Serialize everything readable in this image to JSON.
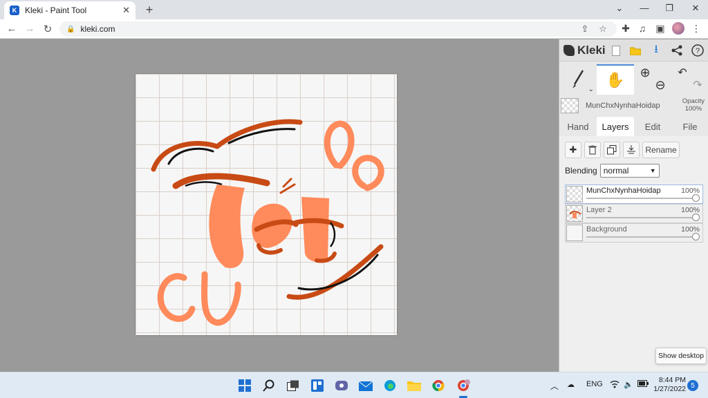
{
  "browser": {
    "tab_title": "Kleki - Paint Tool",
    "url": "kleki.com",
    "new_tab_symbol": "+",
    "close_tab_symbol": "✕"
  },
  "app": {
    "logo_text": "Kleki",
    "tabs": [
      "Hand",
      "Layers",
      "Edit",
      "File"
    ],
    "active_tab": "Layers",
    "current_layer": {
      "name": "MunChxNynhaHoidap",
      "opacity_label": "Opacity",
      "opacity_value": "100%"
    },
    "layer_actions": {
      "rename_label": "Rename"
    },
    "blending": {
      "label": "Blending",
      "value": "normal"
    },
    "layers": [
      {
        "name": "MunChxNynhaHoidap",
        "opacity": "100%",
        "active": true
      },
      {
        "name": "Layer 2",
        "opacity": "100%",
        "active": false
      },
      {
        "name": "Background",
        "opacity": "100%",
        "active": false
      }
    ],
    "canvas_text": "Tết"
  },
  "tooltip": {
    "show_desktop": "Show desktop"
  },
  "taskbar": {
    "language": "ENG",
    "time": "8:44 PM",
    "date": "1/27/2022",
    "notification_count": "5"
  },
  "colors": {
    "accent_dark_orange": "#c84a14",
    "accent_light_orange": "#ff8a5b",
    "active_tab_border": "#4a8ad8"
  }
}
